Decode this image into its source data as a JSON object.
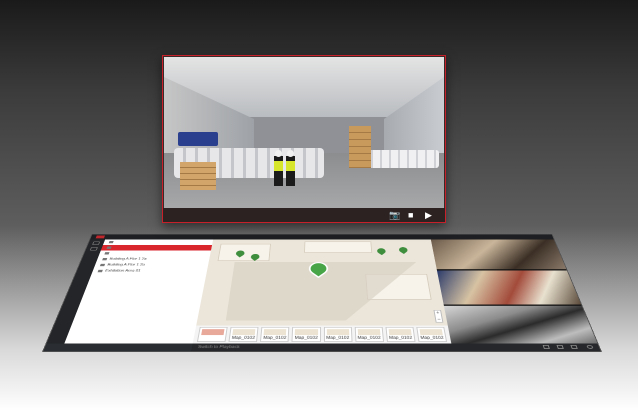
{
  "tree": {
    "items": [
      {
        "label": "",
        "selected": false
      },
      {
        "label": "",
        "selected": true
      },
      {
        "label": "",
        "selected": false
      },
      {
        "label": "Building A Flor 1 2a",
        "selected": false
      },
      {
        "label": "Building A Flor 1 2a",
        "selected": false
      },
      {
        "label": "Exhibition Area 01",
        "selected": false
      }
    ]
  },
  "map_thumbs": [
    {
      "label": "",
      "selected": true
    },
    {
      "label": "Map_0102",
      "selected": false
    },
    {
      "label": "Map_0102",
      "selected": false
    },
    {
      "label": "Map_0102",
      "selected": false
    },
    {
      "label": "Map_0102",
      "selected": false
    },
    {
      "label": "Map_0102",
      "selected": false
    },
    {
      "label": "Map_0102",
      "selected": false
    },
    {
      "label": "Map_0102",
      "selected": false
    }
  ],
  "bottom": {
    "playback_label": "Switch to Playback"
  },
  "popup": {
    "controls": {
      "snapshot": "📷",
      "record": "■",
      "play": "▶"
    }
  },
  "colors": {
    "accent": "#c8202a",
    "pin": "#47a447"
  },
  "icons": [
    "camera-icon",
    "record-icon",
    "play-icon",
    "map-pin-icon"
  ]
}
